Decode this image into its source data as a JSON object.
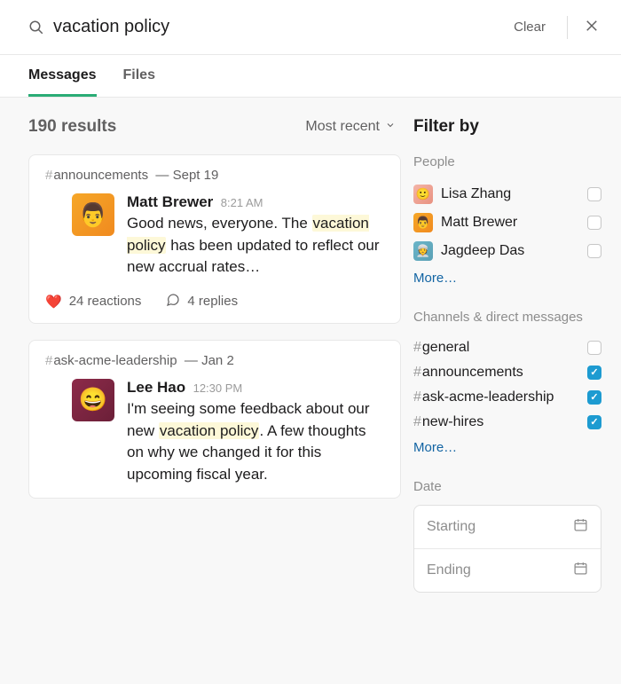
{
  "search": {
    "query": "vacation policy",
    "clear_label": "Clear"
  },
  "tabs": [
    {
      "label": "Messages",
      "active": true
    },
    {
      "label": "Files",
      "active": false
    }
  ],
  "results": {
    "count_label": "190 results",
    "sort_label": "Most recent"
  },
  "messages": [
    {
      "channel": "announcements",
      "date": "Sept 19",
      "author": "Matt Brewer",
      "time": "8:21 AM",
      "avatar_color": "av-orange",
      "avatar_glyph": "👨",
      "text_before": "Good news, everyone. The ",
      "highlight": "vacation policy",
      "text_after": " has been updated to reflect our new accrual rates…",
      "reactions_emoji": "❤️",
      "reactions_label": "24 reactions",
      "replies_label": "4 replies"
    },
    {
      "channel": "ask-acme-leadership",
      "date": "Jan 2",
      "author": "Lee Hao",
      "time": "12:30 PM",
      "avatar_color": "av-maroon",
      "avatar_glyph": "😄",
      "text_before": "I'm seeing some feedback about our new ",
      "highlight": "vacation policy",
      "text_after": ". A few thoughts on why we changed it for this upcoming fiscal year.",
      "reactions_emoji": "",
      "reactions_label": "",
      "replies_label": ""
    }
  ],
  "filter": {
    "title": "Filter by",
    "people_label": "People",
    "people": [
      {
        "name": "Lisa Zhang",
        "avatar_color": "av-pink",
        "checked": false
      },
      {
        "name": "Matt Brewer",
        "avatar_color": "av-orange",
        "checked": false
      },
      {
        "name": "Jagdeep Das",
        "avatar_color": "av-teal",
        "checked": false
      }
    ],
    "more_label": "More…",
    "channels_label": "Channels & direct messages",
    "channels": [
      {
        "name": "general",
        "checked": false
      },
      {
        "name": "announcements",
        "checked": true
      },
      {
        "name": "ask-acme-leadership",
        "checked": true
      },
      {
        "name": "new-hires",
        "checked": true
      }
    ],
    "date_label": "Date",
    "date_start": "Starting",
    "date_end": "Ending"
  }
}
